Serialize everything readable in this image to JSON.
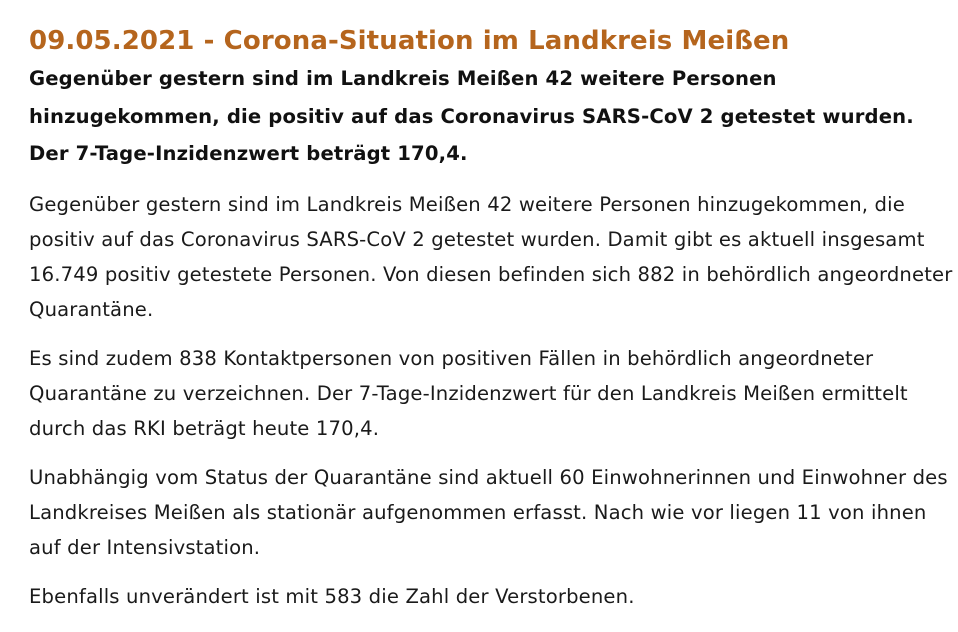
{
  "article": {
    "title": "09.05.2021 - Corona-Situation im Landkreis Meißen",
    "lead": "Gegenüber gestern sind im Landkreis Meißen 42 weitere Personen hinzugekommen, die positiv auf das Coronavirus SARS-CoV 2 getestet wurden. Der 7-Tage-Inzidenzwert beträgt 170,4.",
    "paragraphs": [
      "Gegenüber gestern sind im Landkreis Meißen 42 weitere Personen hinzugekommen, die positiv auf das Coronavirus SARS-CoV 2 getestet wurden. Damit gibt es aktuell insgesamt 16.749 positiv getestete Personen. Von diesen befinden sich 882 in behördlich angeordneter Quarantäne.",
      "Es sind zudem 838 Kontaktpersonen von positiven Fällen in behördlich angeordneter Quarantäne zu verzeichnen. Der 7-Tage-Inzidenzwert für den Landkreis Meißen ermittelt durch das RKI beträgt heute 170,4.",
      "Unabhängig vom Status der Quarantäne sind aktuell 60 Einwohnerinnen und Einwohner des Landkreises Meißen als stationär aufgenommen erfasst. Nach wie vor liegen 11 von ihnen auf der Intensivstation.",
      "Ebenfalls unverändert ist mit 583 die Zahl der Verstorbenen."
    ]
  },
  "colors": {
    "title": "#b5651d",
    "text": "#1a1a1a",
    "background": "#ffffff"
  }
}
